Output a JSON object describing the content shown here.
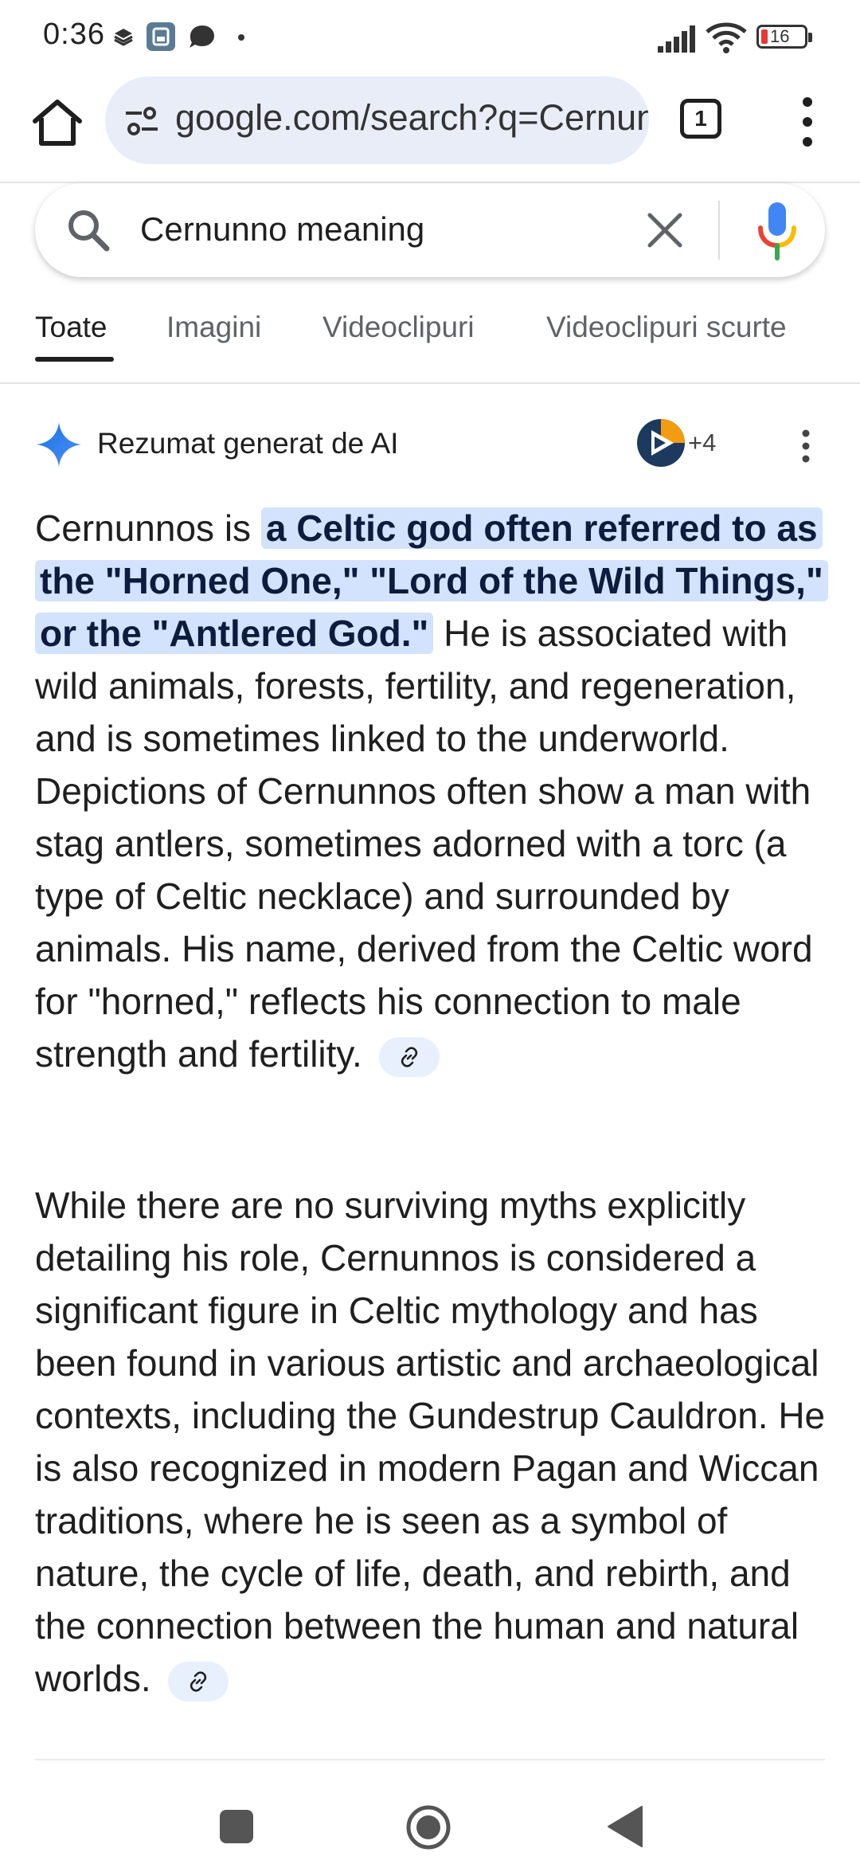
{
  "status_bar": {
    "time": "0:36",
    "battery": "16"
  },
  "browser": {
    "url": "google.com/search?q=Cernunno+meaning",
    "tab_count": "1"
  },
  "search": {
    "query": "Cernunno meaning"
  },
  "filter_tabs": [
    "Toate",
    "Imagini",
    "Videoclipuri",
    "Videoclipuri scurte"
  ],
  "ai_overview": {
    "title": "Rezumat generat de AI",
    "source_count": "+4",
    "p1_start": "Cernunnos is ",
    "p1_highlight": "a Celtic god often referred to as the \"Horned One,\" \"Lord of the Wild Things,\" or the \"Antlered God.\"",
    "p1_rest": " He is associated with wild animals, forests, fertility, and regeneration, and is sometimes linked to the underworld. Depictions of Cernunnos often show a man with stag antlers, sometimes adorned with a torc (a type of Celtic necklace) and surrounded by animals. His name, derived from the Celtic word for \"horned,\" reflects his connection to male strength and fertility.",
    "p2": "While there are no surviving myths explicitly detailing his role, Cernunnos is considered a significant figure in Celtic mythology and has been found in various artistic and archaeological contexts, including the Gundestrup Cauldron. He is also recognized in modern Pagan and Wiccan traditions, where he is seen as a symbol of nature, the cycle of life, death, and rebirth, and the connection between the human and natural worlds."
  },
  "colors": {
    "highlight": "#d3e3fd",
    "accent_blue": "#4285f4",
    "url_pill": "#e8edf8"
  },
  "icons": [
    "home-icon",
    "site-settings-icon",
    "tabs-icon",
    "more-vert-icon",
    "search-icon",
    "clear-icon",
    "mic-icon",
    "ai-sparkle-icon",
    "link-icon",
    "recents-icon",
    "nav-home-icon",
    "back-icon"
  ]
}
